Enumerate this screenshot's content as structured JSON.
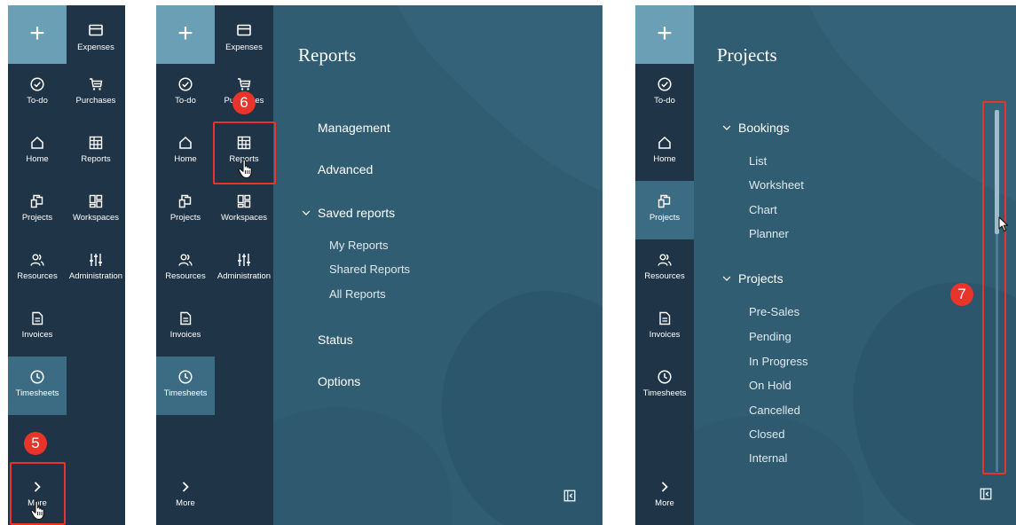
{
  "nav": {
    "plus_label": "+",
    "items": {
      "expenses": "Expenses",
      "todo": "To-do",
      "purchases": "Purchases",
      "home": "Home",
      "reports": "Reports",
      "projects": "Projects",
      "workspaces": "Workspaces",
      "resources": "Resources",
      "administration": "Administration",
      "invoices": "Invoices",
      "timesheets": "Timesheets",
      "more": "More"
    }
  },
  "steps": {
    "five": "5",
    "six": "6",
    "seven": "7"
  },
  "reports_panel": {
    "title": "Reports",
    "items": [
      "Management",
      "Advanced"
    ],
    "saved_reports": {
      "label": "Saved reports",
      "children": [
        "My Reports",
        "Shared Reports",
        "All Reports"
      ]
    },
    "items_after": [
      "Status",
      "Options"
    ]
  },
  "projects_panel": {
    "title": "Projects",
    "bookings": {
      "label": "Bookings",
      "children": [
        "List",
        "Worksheet",
        "Chart",
        "Planner"
      ]
    },
    "projects": {
      "label": "Projects",
      "children": [
        "Pre-Sales",
        "Pending",
        "In Progress",
        "On Hold",
        "Cancelled",
        "Closed",
        "Internal"
      ]
    }
  },
  "colors": {
    "nav_bg": "#1f3447",
    "content_bg": "#315d73",
    "plus_bg": "#6b9fb5",
    "selected_bg": "#3b6c83",
    "highlight": "#e8342a"
  }
}
